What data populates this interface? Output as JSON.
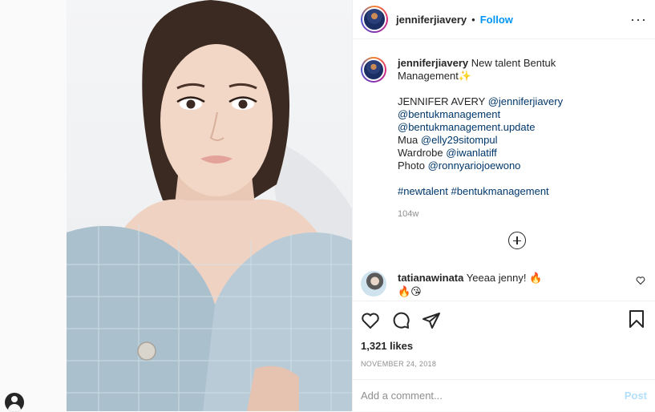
{
  "post": {
    "username": "jenniferjiavery",
    "follow_label": "Follow",
    "dot": "•",
    "more_label": "···"
  },
  "caption": {
    "username": "jenniferjiavery",
    "line1": "New talent Bentuk Management",
    "sparkle": "✨",
    "name_line_prefix": "JENNIFER AVERY ",
    "mention_1": "@jenniferjiavery",
    "mention_2": "@bentukmanagement",
    "mention_3": "@bentukmanagement.update",
    "mua_label": "Mua ",
    "mention_mua": "@elly29sitompul",
    "wardrobe_label": "Wardrobe ",
    "mention_wardrobe": "@iwanlatiff",
    "photo_label": "Photo ",
    "mention_photo": "@ronnyariojoewono",
    "hashtag_1": "#newtalent",
    "hashtag_2": "#bentukmanagement",
    "time": "104w"
  },
  "comment": {
    "username": "tatianawinata",
    "text": "Yeeaa jenny! 🔥",
    "emojis": "🔥😘"
  },
  "actions": {
    "likes": "1,321 likes",
    "date": "NOVEMBER 24, 2018"
  },
  "add_comment": {
    "placeholder": "Add a comment...",
    "post_label": "Post"
  },
  "colors": {
    "link": "#00376b",
    "follow": "#0095f6",
    "post_disabled": "#b2dffc"
  }
}
